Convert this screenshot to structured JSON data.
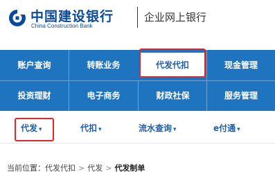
{
  "header": {
    "bank_name_cn": "中国建设银行",
    "bank_name_en": "China Construction Bank",
    "subtitle": "企业网上银行",
    "logo_icon": "ccb-logo-icon"
  },
  "nav": {
    "row1": [
      "账户查询",
      "转账业务",
      "代发代扣",
      "现金管理"
    ],
    "row2": [
      "投资理财",
      "电子商务",
      "财政社保",
      "服务管理"
    ],
    "active": "代发代扣"
  },
  "subnav": {
    "items": [
      "代发",
      "代扣",
      "流水查询",
      "e付通"
    ],
    "active": "代发",
    "chevron_icon": "chevron-down-icon"
  },
  "breadcrumb": {
    "prefix": "当前位置：",
    "items": [
      "代发代扣",
      "代发",
      "代发制单"
    ],
    "separator": ">"
  },
  "colors": {
    "nav_bg": "#1f74c0",
    "brand_blue": "#0a4a9b",
    "highlight_red": "#e0262b"
  }
}
